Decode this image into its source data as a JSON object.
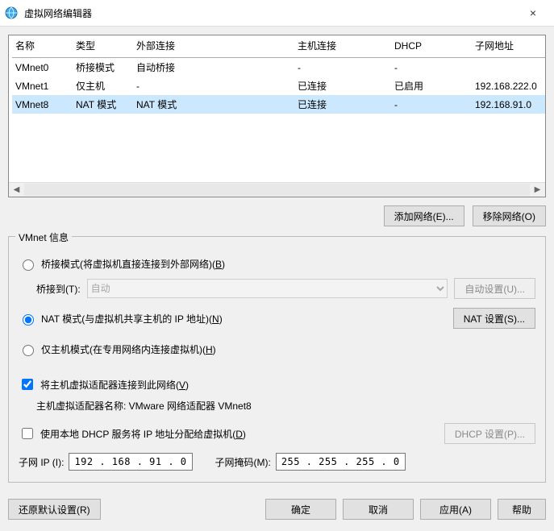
{
  "titlebar": {
    "title": "虚拟网络编辑器",
    "close_label": "×"
  },
  "grid": {
    "columns": [
      "名称",
      "类型",
      "外部连接",
      "主机连接",
      "DHCP",
      "子网地址"
    ],
    "rows": [
      {
        "name": "VMnet0",
        "type": "桥接模式",
        "external": "自动桥接",
        "host": "-",
        "dhcp": "-",
        "subnet": ""
      },
      {
        "name": "VMnet1",
        "type": "仅主机",
        "external": "-",
        "host": "已连接",
        "dhcp": "已启用",
        "subnet": "192.168.222.0"
      },
      {
        "name": "VMnet8",
        "type": "NAT 模式",
        "external": "NAT 模式",
        "host": "已连接",
        "dhcp": "-",
        "subnet": "192.168.91.0"
      }
    ],
    "selected_index": 2
  },
  "buttons": {
    "add_network": "添加网络(E)...",
    "remove_network": "移除网络(O)"
  },
  "vmnet_info": {
    "legend": "VMnet 信息",
    "bridge": {
      "label_prefix": "桥接模式(将虚拟机直接连接到外部网络)(",
      "label_hotkey": "B",
      "label_suffix": ")",
      "sub_label": "桥接到(T):",
      "combo_value": "自动",
      "auto_btn": "自动设置(U)..."
    },
    "nat": {
      "label_prefix": "NAT 模式(与虚拟机共享主机的 IP 地址)(",
      "label_hotkey": "N",
      "label_suffix": ")",
      "settings_btn": "NAT 设置(S)..."
    },
    "hostonly": {
      "label_prefix": "仅主机模式(在专用网络内连接虚拟机)(",
      "label_hotkey": "H",
      "label_suffix": ")"
    },
    "host_adapter": {
      "check_label_prefix": "将主机虚拟适配器连接到此网络(",
      "check_label_hotkey": "V",
      "check_label_suffix": ")",
      "name_label": "主机虚拟适配器名称: VMware 网络适配器 VMnet8"
    },
    "dhcp": {
      "check_label_prefix": "使用本地 DHCP 服务将 IP 地址分配给虚拟机(",
      "check_label_hotkey": "D",
      "check_label_suffix": ")",
      "settings_btn": "DHCP 设置(P)..."
    },
    "subnet": {
      "ip_label": "子网 IP (I):",
      "ip_value": "192 . 168 . 91 . 0",
      "mask_label": "子网掩码(M):",
      "mask_value": "255 . 255 . 255 . 0"
    }
  },
  "footer": {
    "restore_defaults": "还原默认设置(R)",
    "ok": "确定",
    "cancel": "取消",
    "apply": "应用(A)",
    "help": "帮助"
  }
}
